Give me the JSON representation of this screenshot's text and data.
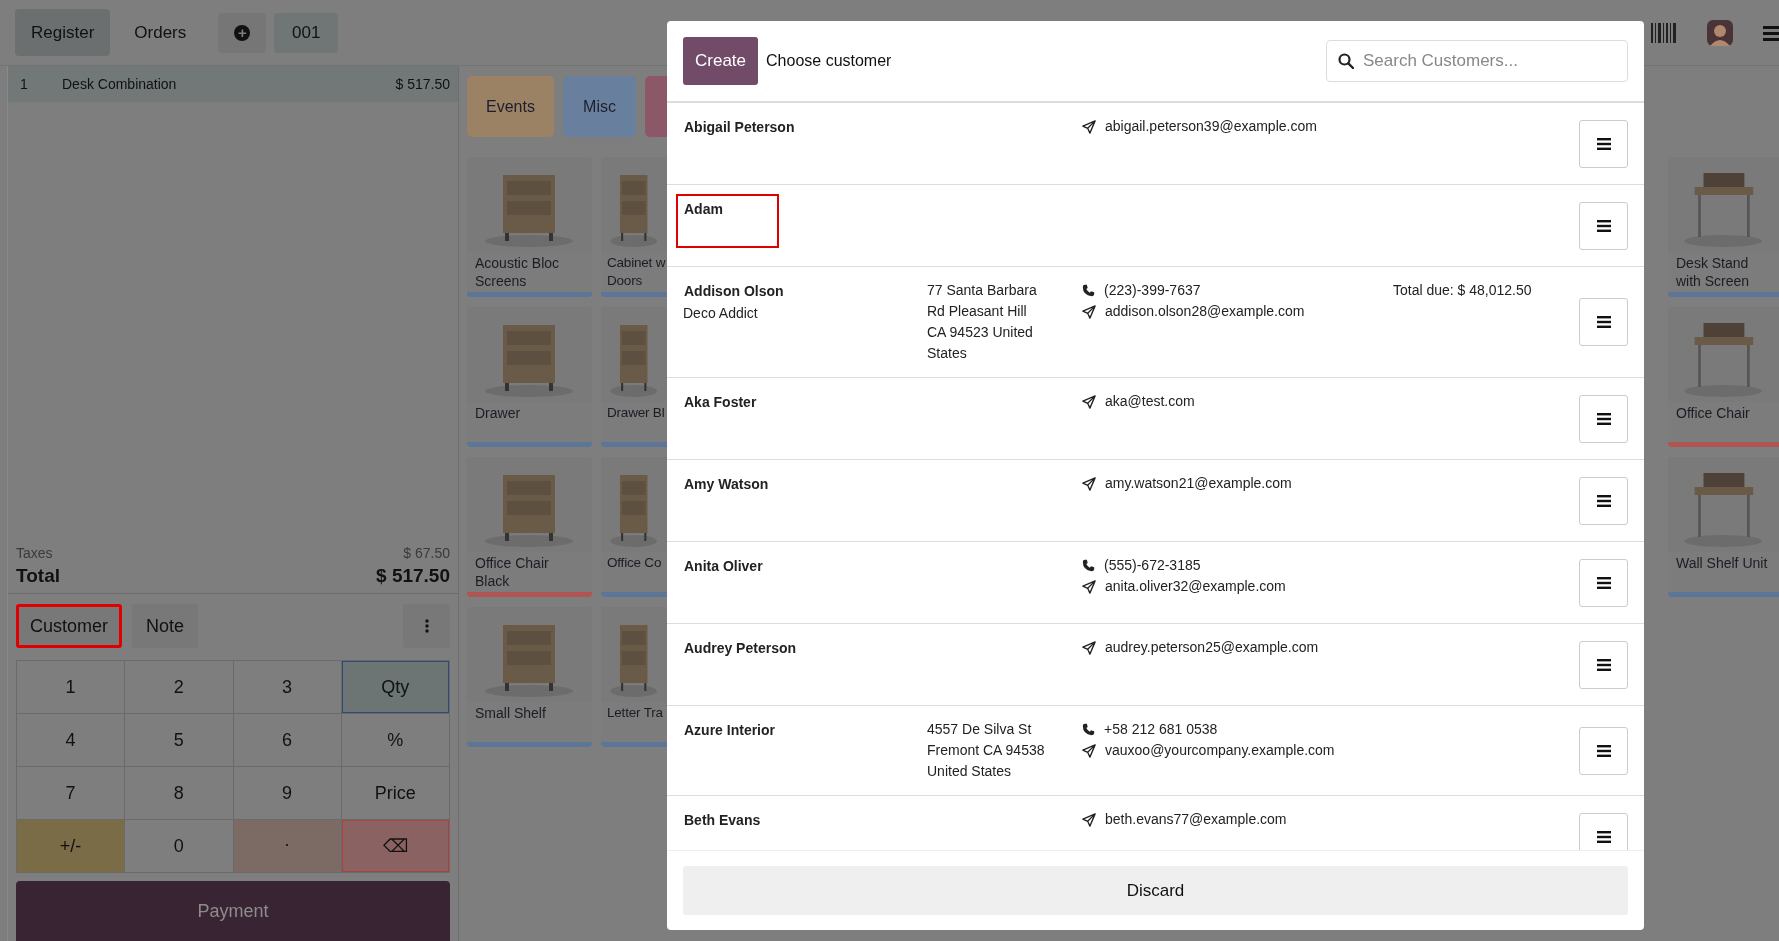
{
  "top_bar": {
    "tabs": [
      {
        "label": "Register",
        "selected": true
      },
      {
        "label": "Orders",
        "selected": false
      }
    ],
    "new_order_icon": "+",
    "order_ref": "001"
  },
  "order": {
    "lines": [
      {
        "qty": "1",
        "product": "Desk Combination",
        "price": "$ 517.50",
        "selected": true
      }
    ],
    "taxes_label": "Taxes",
    "taxes": "$ 67.50",
    "total_label": "Total",
    "total": "$ 517.50"
  },
  "actions": [
    {
      "label": "Customer",
      "highlighted": true
    },
    {
      "label": "Note",
      "highlighted": false
    }
  ],
  "numpad": [
    {
      "label": "1",
      "kind": "digit"
    },
    {
      "label": "2",
      "kind": "digit"
    },
    {
      "label": "3",
      "kind": "digit"
    },
    {
      "label": "Qty",
      "kind": "mode",
      "selected": true
    },
    {
      "label": "4",
      "kind": "digit"
    },
    {
      "label": "5",
      "kind": "digit"
    },
    {
      "label": "6",
      "kind": "digit"
    },
    {
      "label": "%",
      "kind": "mode",
      "selected": false
    },
    {
      "label": "7",
      "kind": "digit"
    },
    {
      "label": "8",
      "kind": "digit"
    },
    {
      "label": "9",
      "kind": "digit"
    },
    {
      "label": "Price",
      "kind": "mode",
      "selected": false
    },
    {
      "label": "+/-",
      "kind": "sign"
    },
    {
      "label": "0",
      "kind": "digit"
    },
    {
      "label": ".",
      "kind": "dot"
    },
    {
      "label": "⌫",
      "kind": "erase"
    }
  ],
  "payment_button": "Payment",
  "categories": [
    {
      "label": "Events",
      "color": "#9c8264"
    },
    {
      "label": "Misc",
      "color": "#68809e"
    },
    {
      "color": "#8c5766"
    }
  ],
  "products_left": [
    [
      {
        "name": "Acoustic Bloc Screens",
        "color": "#5d7698"
      },
      {
        "name": "Drawer",
        "color": "#5d7698"
      },
      {
        "name": "Office Chair Black",
        "color": "#b05454"
      },
      {
        "name": "Small Shelf",
        "color": "#5d7698"
      }
    ],
    [
      {
        "name": "Cabinet w Doors",
        "color": "#5d7698"
      },
      {
        "name": "Drawer Bl",
        "color": "#5d7698"
      },
      {
        "name": "Office Co",
        "color": "#5d7698"
      },
      {
        "name": "Letter Tra",
        "color": "#5d7698"
      }
    ]
  ],
  "products_right": [
    {
      "name": "Desk Stand with Screen",
      "color": "#5d7698"
    },
    {
      "name": "Office Chair",
      "color": "#b05454"
    },
    {
      "name": "Wall Shelf Unit",
      "color": "#5d7698"
    }
  ],
  "dialog": {
    "create_button": "Create",
    "title": "Choose customer",
    "search": {
      "placeholder": "Search Customers..."
    },
    "customers": [
      {
        "name": "Abigail Peterson",
        "email": "abigail.peterson39@example.com",
        "highlighted": false
      },
      {
        "name": "Adam",
        "highlighted": true
      },
      {
        "name": "Addison Olson",
        "company": "Deco Addict",
        "address": "77 Santa Barbara Rd Pleasant Hill CA 94523 United States",
        "phone": "(223)-399-7637",
        "email": "addison.olson28@example.com",
        "total_due": "Total due: $ 48,012.50",
        "highlighted": false
      },
      {
        "name": "Aka Foster",
        "email": "aka@test.com",
        "highlighted": false
      },
      {
        "name": "Amy Watson",
        "email": "amy.watson21@example.com",
        "highlighted": false
      },
      {
        "name": "Anita Oliver",
        "phone": "(555)-672-3185",
        "email": "anita.oliver32@example.com",
        "highlighted": false
      },
      {
        "name": "Audrey Peterson",
        "email": "audrey.peterson25@example.com",
        "highlighted": false
      },
      {
        "name": "Azure Interior",
        "address": "4557 De Silva St Fremont CA 94538 United States",
        "phone": "+58 212 681 0538",
        "email": "vauxoo@yourcompany.example.com",
        "highlighted": false
      },
      {
        "name": "Beth Evans",
        "email": "beth.evans77@example.com",
        "highlighted": false
      }
    ],
    "discard_button": "Discard"
  }
}
